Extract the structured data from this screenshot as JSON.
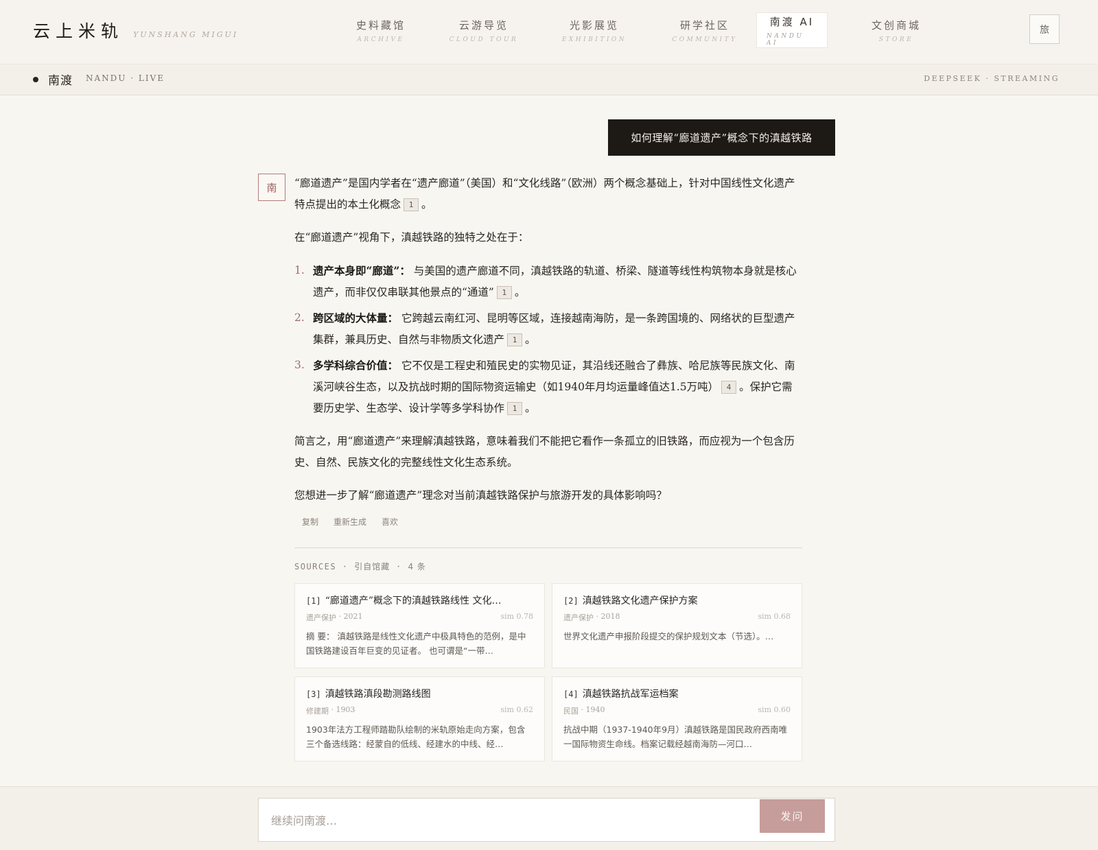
{
  "brand": {
    "name": "云上米轨",
    "subtitle": "YUNSHANG MIGUI"
  },
  "nav": [
    {
      "zh": "史料藏馆",
      "en": "ARCHIVE"
    },
    {
      "zh": "云游导览",
      "en": "CLOUD TOUR"
    },
    {
      "zh": "光影展览",
      "en": "EXHIBITION"
    },
    {
      "zh": "研学社区",
      "en": "COMMUNITY"
    },
    {
      "zh": "南渡 AI",
      "en": "NANDU AI",
      "active": true
    },
    {
      "zh": "文创商城",
      "en": "STORE"
    }
  ],
  "corner_button": "旅",
  "status": {
    "name": "南渡",
    "sub": "NANDU · LIVE",
    "right": "DEEPSEEK · STREAMING"
  },
  "user_message": "如何理解“廊道遗产”概念下的滇越铁路",
  "ai": {
    "avatar": "南",
    "intro": "“廊道遗产”是国内学者在“遗产廊道”（美国）和“文化线路”（欧洲）两个概念基础上，针对中国线性文化遗产特点提出的本土化概念",
    "intro_cite": "1",
    "lead": "在“廊道遗产”视角下，滇越铁路的独特之处在于：",
    "points": [
      {
        "num": "1.",
        "head": "遗产本身即“廊道”：",
        "body": "与美国的遗产廊道不同，滇越铁路的轨道、桥梁、隧道等线性构筑物本身就是核心遗产，而非仅仅串联其他景点的“通道”",
        "cite": "1"
      },
      {
        "num": "2.",
        "head": "跨区域的大体量：",
        "body": "它跨越云南红河、昆明等区域，连接越南海防，是一条跨国境的、网络状的巨型遗产集群，兼具历史、自然与非物质文化遗产",
        "cite": "1"
      },
      {
        "num": "3.",
        "head": "多学科综合价值：",
        "body": "它不仅是工程史和殖民史的实物见证，其沿线还融合了彝族、哈尼族等民族文化、南溪河峡谷生态，以及抗战时期的国际物资运输史（如1940年月均运量峰值达1.5万吨）",
        "cite": "4",
        "tail": "。保护它需要历史学、生态学、设计学等多学科协作",
        "cite2": "1"
      }
    ],
    "summary": "简言之，用“廊道遗产”来理解滇越铁路，意味着我们不能把它看作一条孤立的旧铁路，而应视为一个包含历史、自然、民族文化的完整线性文化生态系统。",
    "followup": "您想进一步了解“廊道遗产”理念对当前滇越铁路保护与旅游开发的具体影响吗？",
    "actions": {
      "copy": "复制",
      "regenerate": "重新生成",
      "like": "喜欢"
    }
  },
  "sources": {
    "label": "SOURCES",
    "label_zh": "引自馆藏",
    "count": "4 条",
    "items": [
      {
        "idx": "[1]",
        "title": "“廊道遗产”概念下的滇越铁路线性 文化…",
        "tag": "遗产保护",
        "year": "· 2021",
        "sim": "sim 0.78",
        "abstract": "摘 要： 滇越铁路是线性文化遗产中极具特色的范例，是中国铁路建设百年巨变的见证者。 也可谓是“一带…"
      },
      {
        "idx": "[2]",
        "title": "滇越铁路文化遗产保护方案",
        "tag": "遗产保护",
        "year": "· 2018",
        "sim": "sim 0.68",
        "abstract": "世界文化遗产申报阶段提交的保护规划文本（节选）。…"
      },
      {
        "idx": "[3]",
        "title": "滇越铁路滇段勘测路线图",
        "tag": "修建期",
        "year": "· 1903",
        "sim": "sim 0.62",
        "abstract": "1903年法方工程师踏勘队绘制的米轨原始走向方案，包含三个备选线路：经蒙自的低线、经建水的中线、经…"
      },
      {
        "idx": "[4]",
        "title": "滇越铁路抗战军运档案",
        "tag": "民国",
        "year": "· 1940",
        "sim": "sim 0.60",
        "abstract": "抗战中期（1937-1940年9月）滇越铁路是国民政府西南唯一国际物资生命线。档案记载经越南海防—河口…"
      }
    ]
  },
  "composer": {
    "placeholder": "继续问南渡…",
    "send": "发问"
  }
}
